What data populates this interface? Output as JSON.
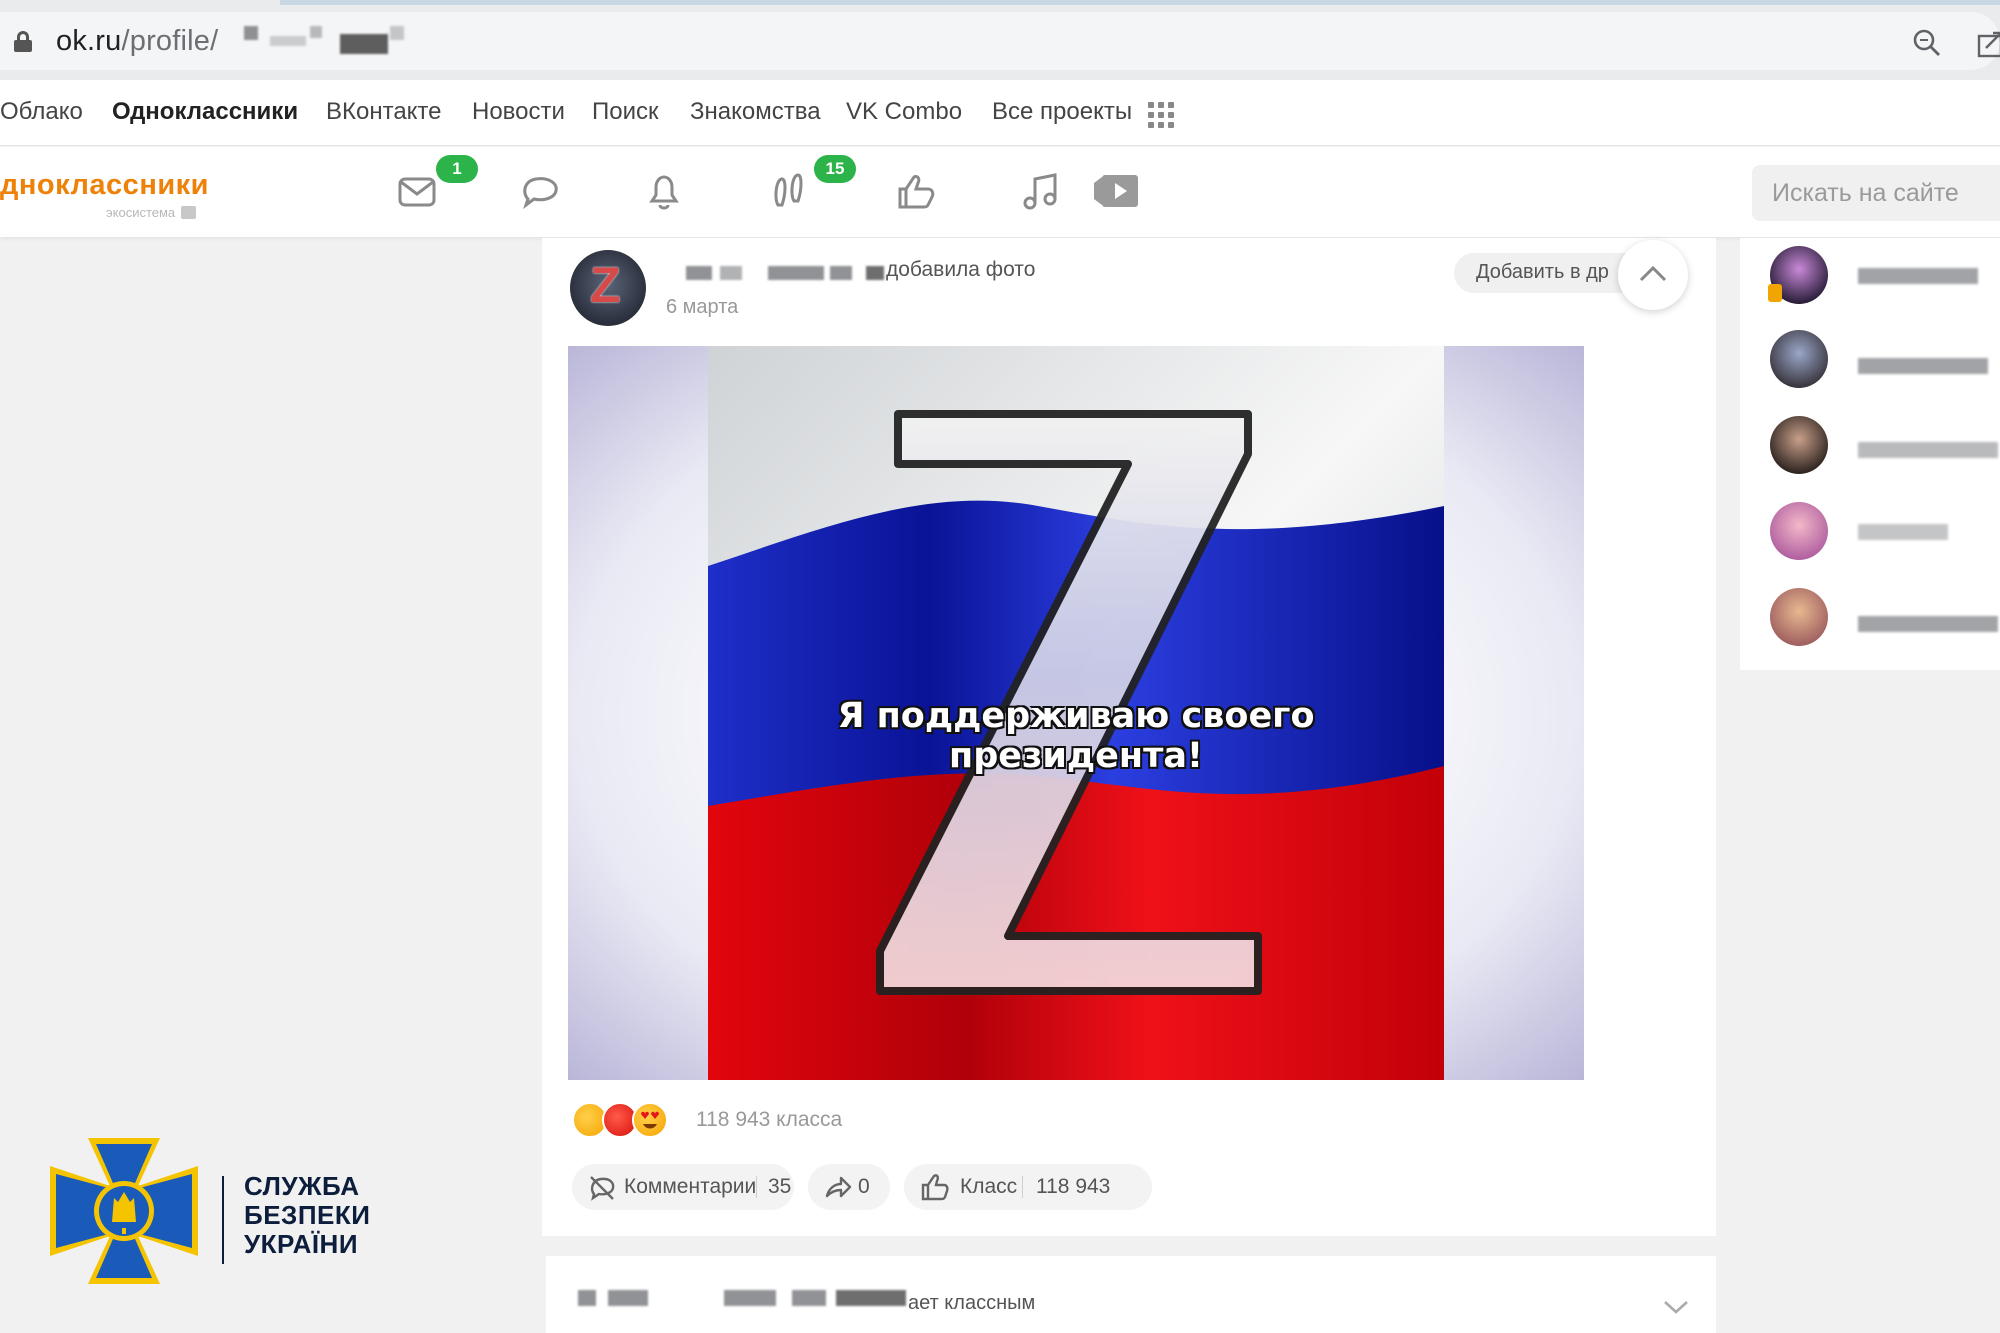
{
  "browser": {
    "url_domain": "ok.ru",
    "url_path": "/profile/"
  },
  "portal_nav": {
    "items": [
      "Облако",
      "Одноклассники",
      "ВКонтакте",
      "Новости",
      "Поиск",
      "Знакомства",
      "VK Combo",
      "Все проекты"
    ],
    "active": "Одноклассники"
  },
  "header": {
    "logo_text": "дноклассники",
    "logo_sub": "экосистема",
    "messages_badge": "1",
    "events_badge": "15",
    "search_placeholder": "Искать на сайте"
  },
  "post": {
    "action": "добавила фото",
    "date": "6 марта",
    "add_button": "Добавить в др",
    "photo_caption": "Я поддерживаю своего президента!",
    "reactions_count": "118 943 класса",
    "comments_label": "Комментарии",
    "comments_count": "35",
    "share_count": "0",
    "class_label": "Класс",
    "class_count": "118 943"
  },
  "post2": {
    "action_fragment": "ает классным"
  },
  "sbu": {
    "line1": "СЛУЖБА",
    "line2": "БЕЗПЕКИ",
    "line3": "УКРАЇНИ"
  },
  "colors": {
    "ok_orange": "#ee8208",
    "badge_green": "#2cb34a",
    "sbu_blue": "#1a5ab8",
    "sbu_gold": "#f5c400"
  }
}
